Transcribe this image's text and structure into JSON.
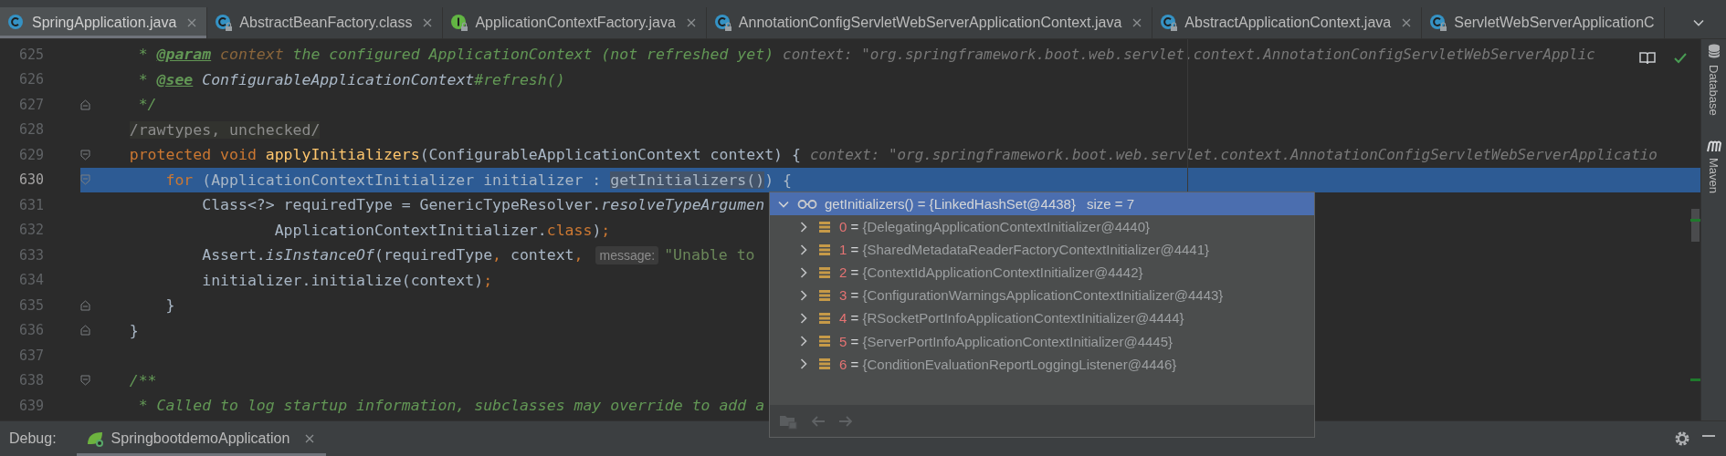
{
  "editor_tabs": [
    {
      "label": "SpringApplication.java",
      "kind": "class",
      "locked": false,
      "selected": true
    },
    {
      "label": "AbstractBeanFactory.class",
      "kind": "class",
      "locked": true,
      "selected": false
    },
    {
      "label": "ApplicationContextFactory.java",
      "kind": "interface",
      "locked": true,
      "selected": false
    },
    {
      "label": "AnnotationConfigServletWebServerApplicationContext.java",
      "kind": "class",
      "locked": true,
      "selected": false
    },
    {
      "label": "AbstractApplicationContext.java",
      "kind": "class",
      "locked": true,
      "selected": false
    },
    {
      "label": "ServletWebServerApplicationC",
      "kind": "class",
      "locked": true,
      "selected": false
    }
  ],
  "code_lines": [
    {
      "number": "625",
      "kind": "code",
      "selected": false,
      "tokens": [
        {
          "text": "     * ",
          "kind": "comment"
        },
        {
          "text": "@param",
          "kind": "doctag"
        },
        {
          "text": " context",
          "kind": "docparam"
        },
        {
          "text": " the configured ApplicationContext (not refreshed yet)",
          "kind": "comment"
        },
        {
          "text": "context: \"org.springframework.boot.web.servlet.context.AnnotationConfigServletWebServerApplic",
          "kind": "hint"
        }
      ]
    },
    {
      "number": "626",
      "kind": "code",
      "selected": false,
      "tokens": [
        {
          "text": "     * ",
          "kind": "comment"
        },
        {
          "text": "@see",
          "kind": "doctag"
        },
        {
          "text": " ConfigurableApplicationContext",
          "kind": "docref"
        },
        {
          "text": "#refresh()",
          "kind": "comment"
        }
      ]
    },
    {
      "number": "627",
      "kind": "fold-end",
      "selected": false,
      "tokens": [
        {
          "text": "     */",
          "kind": "comment"
        }
      ]
    },
    {
      "number": "628",
      "kind": "code",
      "selected": false,
      "tokens": [
        {
          "text": "    /rawtypes, unchecked/",
          "kind": "suppress"
        }
      ]
    },
    {
      "number": "629",
      "kind": "fold-start",
      "selected": false,
      "tokens": [
        {
          "text": "    protected void ",
          "kind": "keyword"
        },
        {
          "text": "applyInitializers",
          "kind": "method"
        },
        {
          "text": "(ConfigurableApplicationContext context) {",
          "kind": "plain"
        },
        {
          "text": "context: \"org.springframework.boot.web.servlet.context.AnnotationConfigServletWebServerApplicatio",
          "kind": "hint"
        }
      ]
    },
    {
      "number": "630",
      "kind": "fold-start",
      "selected": true,
      "tokens": [
        {
          "text": "        for ",
          "kind": "keyword"
        },
        {
          "text": "(ApplicationContextInitializer initializer : ",
          "kind": "plain"
        },
        {
          "text": "getInitializers()",
          "kind": "highlight"
        },
        {
          "text": ") {",
          "kind": "plain"
        }
      ]
    },
    {
      "number": "631",
      "kind": "code",
      "selected": false,
      "tokens": [
        {
          "text": "            Class<?> requiredType = GenericTypeResolver.",
          "kind": "plain"
        },
        {
          "text": "resolveTypeArgumen",
          "kind": "static"
        }
      ]
    },
    {
      "number": "632",
      "kind": "code",
      "selected": false,
      "tokens": [
        {
          "text": "                    ApplicationContextInitializer.",
          "kind": "plain"
        },
        {
          "text": "class",
          "kind": "keyword"
        },
        {
          "text": ")",
          "kind": "plain"
        },
        {
          "text": ";",
          "kind": "keyword"
        }
      ]
    },
    {
      "number": "633",
      "kind": "code",
      "selected": false,
      "tokens": [
        {
          "text": "            Assert.",
          "kind": "plain"
        },
        {
          "text": "isInstanceOf",
          "kind": "static"
        },
        {
          "text": "(requiredType",
          "kind": "plain"
        },
        {
          "text": ", ",
          "kind": "keyword"
        },
        {
          "text": "context",
          "kind": "plain"
        },
        {
          "text": ",",
          "kind": "keyword"
        },
        {
          "text": "message:",
          "kind": "paramhint"
        },
        {
          "text": "\"Unable to",
          "kind": "string"
        }
      ]
    },
    {
      "number": "634",
      "kind": "code",
      "selected": false,
      "tokens": [
        {
          "text": "            initializer.initialize(context)",
          "kind": "plain"
        },
        {
          "text": ";",
          "kind": "keyword"
        }
      ]
    },
    {
      "number": "635",
      "kind": "fold-end",
      "selected": false,
      "tokens": [
        {
          "text": "        }",
          "kind": "plain"
        }
      ]
    },
    {
      "number": "636",
      "kind": "fold-end",
      "selected": false,
      "tokens": [
        {
          "text": "    }",
          "kind": "plain"
        }
      ]
    },
    {
      "number": "637",
      "kind": "code",
      "selected": false
    },
    {
      "number": "638",
      "kind": "fold-start",
      "selected": false,
      "tokens": [
        {
          "text": "    /**",
          "kind": "comment"
        }
      ]
    },
    {
      "number": "639",
      "kind": "code",
      "selected": false,
      "tokens": [
        {
          "text": "     * Called to log startup information, subclasses may override to add a",
          "kind": "comment"
        }
      ]
    }
  ],
  "debug_popup": {
    "expanded": true,
    "expression": "getInitializers() = {LinkedHashSet@4438}",
    "size": "size = 7",
    "items": [
      {
        "index": "0",
        "operator": "=",
        "value": "{DelegatingApplicationContextInitializer@4440}",
        "expanded": false
      },
      {
        "index": "1",
        "operator": "=",
        "value": "{SharedMetadataReaderFactoryContextInitializer@4441}",
        "expanded": false
      },
      {
        "index": "2",
        "operator": "=",
        "value": "{ContextIdApplicationContextInitializer@4442}",
        "expanded": false
      },
      {
        "index": "3",
        "operator": "=",
        "value": "{ConfigurationWarningsApplicationContextInitializer@4443}",
        "expanded": false
      },
      {
        "index": "4",
        "operator": "=",
        "value": "{RSocketPortInfoApplicationContextInitializer@4444}",
        "expanded": false
      },
      {
        "index": "5",
        "operator": "=",
        "value": "{ServerPortInfoApplicationContextInitializer@4445}",
        "expanded": false
      },
      {
        "index": "6",
        "operator": "=",
        "value": "{ConditionEvaluationReportLoggingListener@4446}",
        "expanded": false
      }
    ]
  },
  "right_toolbar": [
    {
      "label": "Database",
      "kind": "database"
    },
    {
      "label": "Maven",
      "kind": "maven"
    }
  ],
  "debug_bar": {
    "label": "Debug:",
    "session": "SpringbootdemoApplication"
  }
}
